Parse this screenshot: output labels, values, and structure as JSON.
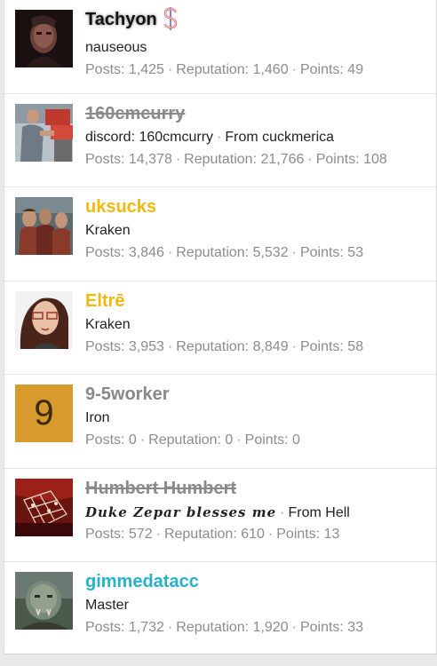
{
  "members": [
    {
      "username": "Tachyon",
      "line2": "nauseous",
      "badge_icon": "dollar-sign-icon",
      "stats": {
        "posts": "Posts: 1,425",
        "reputation": "Reputation: 1,460",
        "points": "Points: 49"
      }
    },
    {
      "username": "160cmcurry",
      "line2_a": "discord: 160cmcurry",
      "line2_b": "From cuckmerica",
      "stats": {
        "posts": "Posts: 14,378",
        "reputation": "Reputation: 21,766",
        "points": "Points: 108"
      }
    },
    {
      "username": "uksucks",
      "line2": "Kraken",
      "stats": {
        "posts": "Posts: 3,846",
        "reputation": "Reputation: 5,532",
        "points": "Points: 53"
      }
    },
    {
      "username": "Eltrē",
      "line2": "Kraken",
      "stats": {
        "posts": "Posts: 3,953",
        "reputation": "Reputation: 8,849",
        "points": "Points: 58"
      }
    },
    {
      "username": "9-5worker",
      "line2": "Iron",
      "avatar_letter": "9",
      "stats": {
        "posts": "Posts: 0",
        "reputation": "Reputation: 0",
        "points": "Points: 0"
      }
    },
    {
      "username": "Humbert Humbert",
      "line2_a": "Duke Zepar blesses me",
      "line2_b": "From Hell",
      "stats": {
        "posts": "Posts: 572",
        "reputation": "Reputation: 610",
        "points": "Points: 13"
      }
    },
    {
      "username": "gimmedatacc",
      "line2": "Master",
      "stats": {
        "posts": "Posts: 1,732",
        "reputation": "Reputation: 1,920",
        "points": "Points: 33"
      }
    }
  ],
  "separator": "·",
  "colors": {
    "gold_username": "#f0b90c",
    "teal_username": "#25b2c9",
    "banned_username": "#8a8a8a",
    "stats_text": "#8c8c8c",
    "letter_avatar_bg": "#d79a2c"
  }
}
